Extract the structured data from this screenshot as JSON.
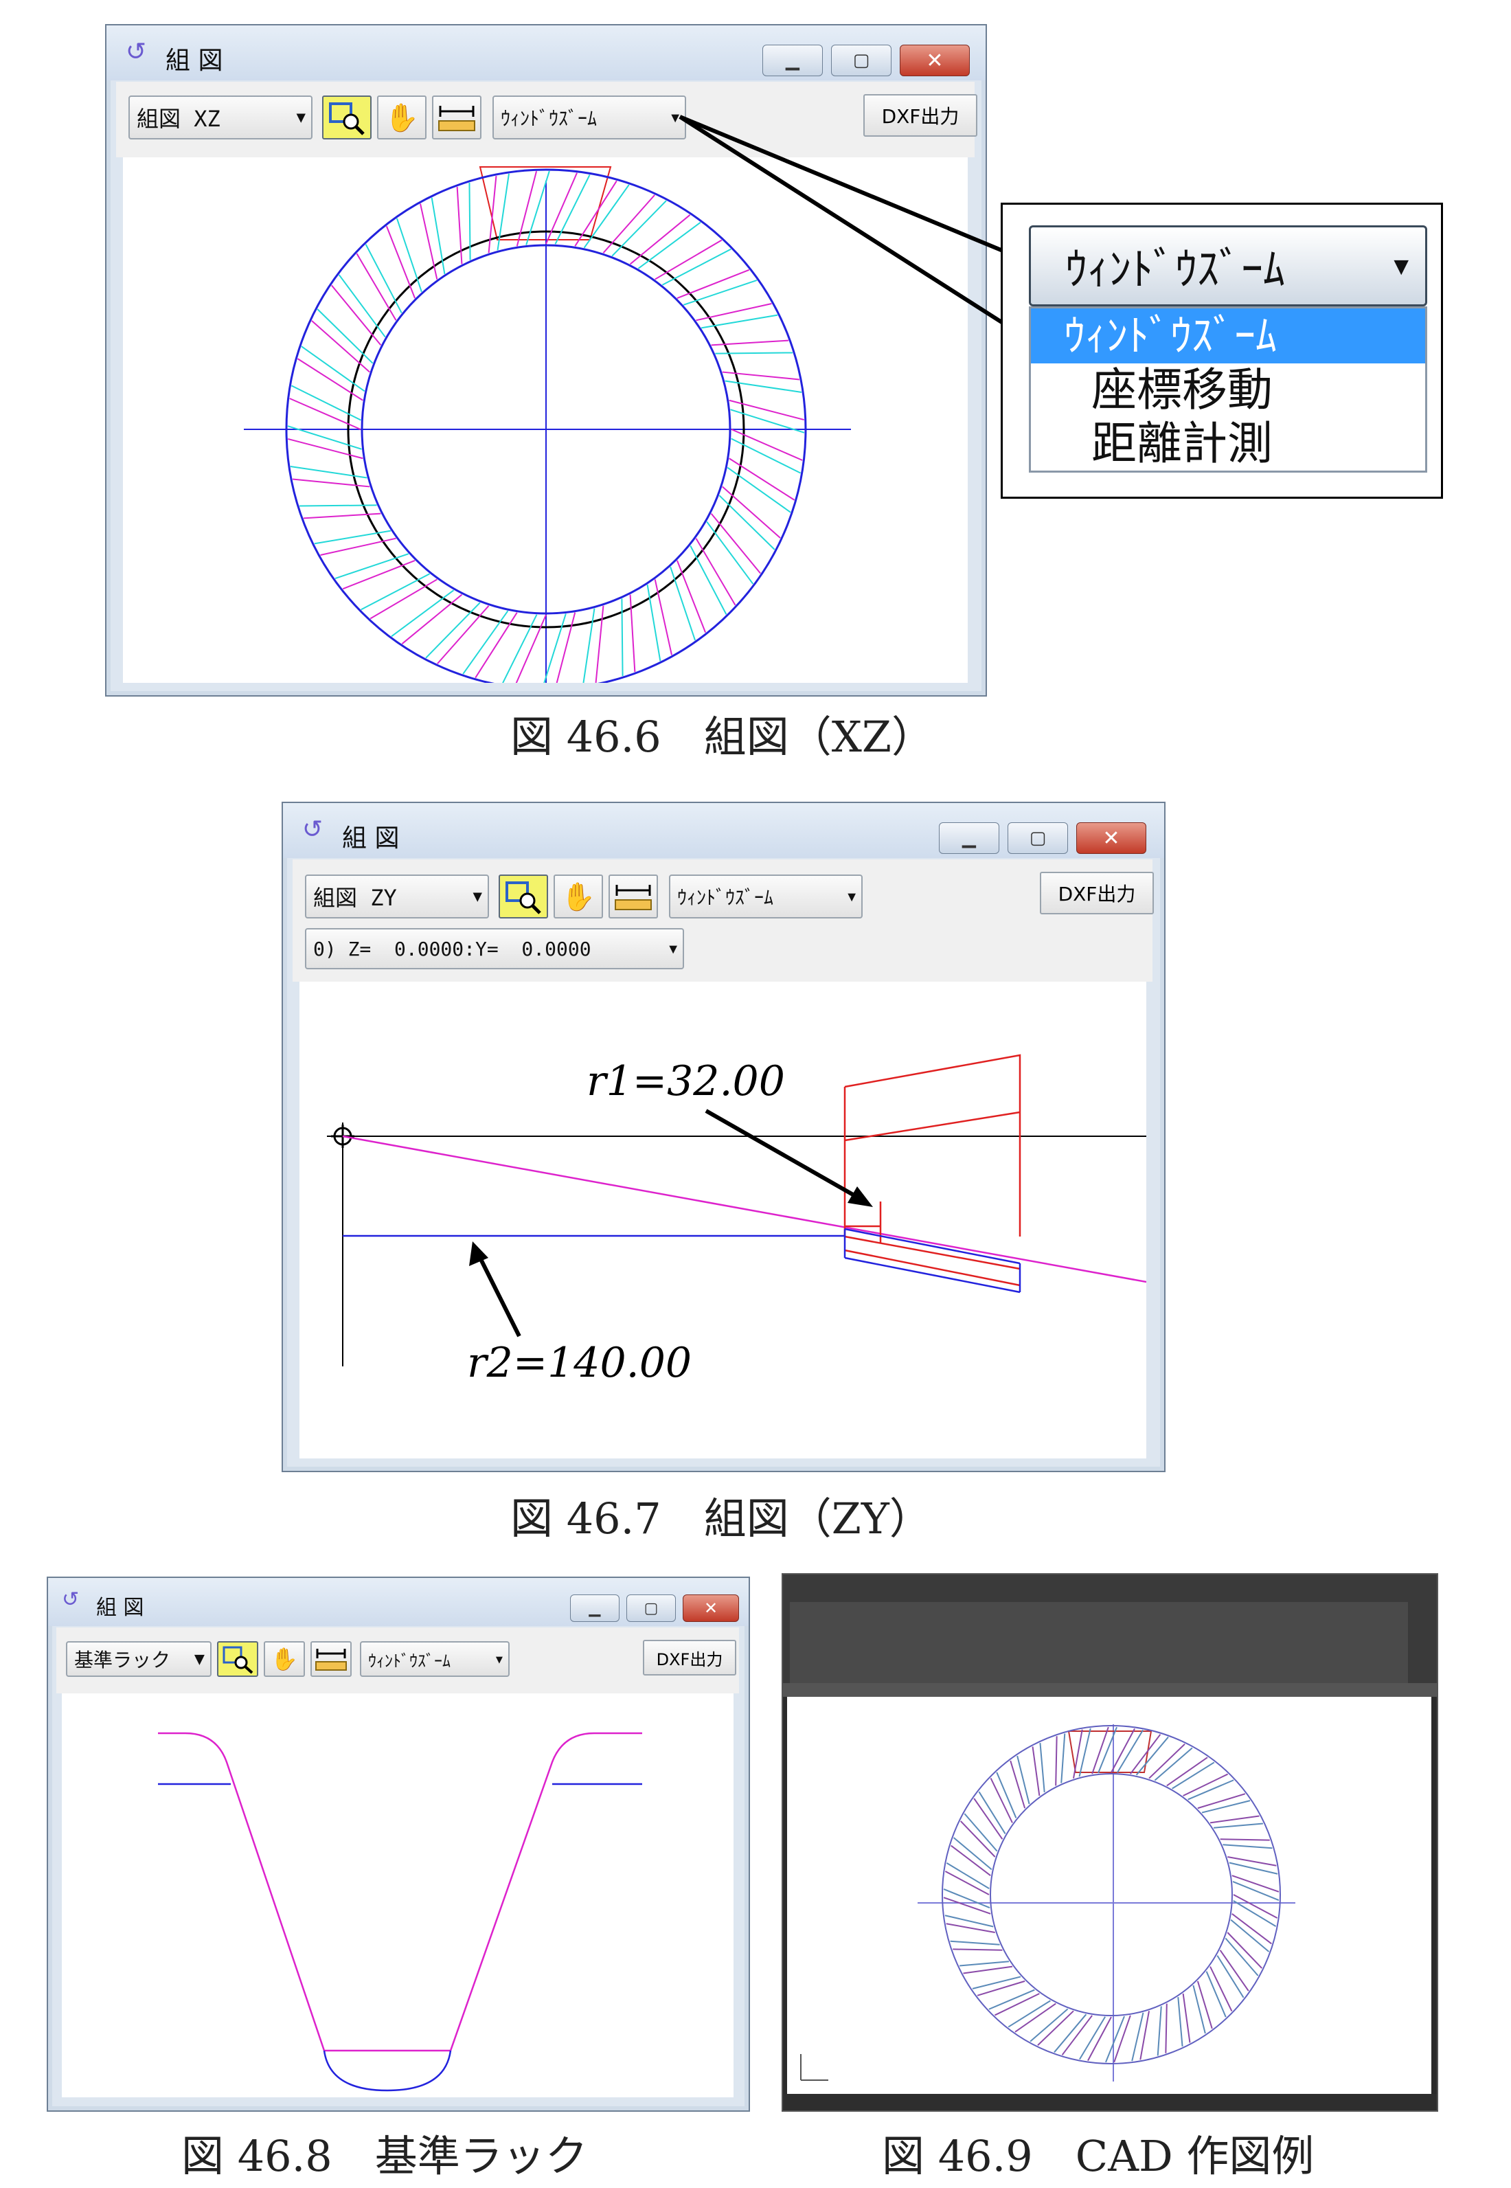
{
  "colors": {
    "blue": "#2222dd",
    "magenta": "#dd22cc",
    "cyan": "#22d8d8",
    "red": "#e02020",
    "black": "#000000",
    "selection": "#3399ff"
  },
  "icons": {
    "app": "swirl-icon",
    "zoom_tool": "magnifier-icon",
    "pan_tool": "hand-icon",
    "measure_tool": "ruler-icon",
    "minimize": "minimize-icon",
    "maximize": "maximize-icon",
    "close": "close-icon"
  },
  "win1": {
    "title": "組 図",
    "view_select": "組図 XZ",
    "mode_select": "ｳｨﾝﾄﾞｳｽﾞｰﾑ",
    "dxf_label": "DXF出力",
    "caption": "図 46.6　組図（XZ）"
  },
  "dropdown": {
    "selected": "ｳｨﾝﾄﾞｳｽﾞｰﾑ",
    "options": [
      "ｳｨﾝﾄﾞｳｽﾞｰﾑ",
      "座標移動",
      "距離計測"
    ]
  },
  "win2": {
    "title": "組 図",
    "view_select": "組図 ZY",
    "mode_select": "ｳｨﾝﾄﾞｳｽﾞｰﾑ",
    "dxf_label": "DXF出力",
    "coord_select": "0) Z=  0.0000:Y=  0.0000",
    "label_r1": "r1=32.00",
    "label_r2": "r2=140.00",
    "caption": "図 46.7　組図（ZY）"
  },
  "win3": {
    "title": "組 図",
    "view_select": "基準ラック",
    "mode_select": "ｳｨﾝﾄﾞｳｽﾞｰﾑ",
    "dxf_label": "DXF出力",
    "caption": "図 46.8　基準ラック"
  },
  "fig4": {
    "caption": "図 46.9　CAD 作図例"
  }
}
